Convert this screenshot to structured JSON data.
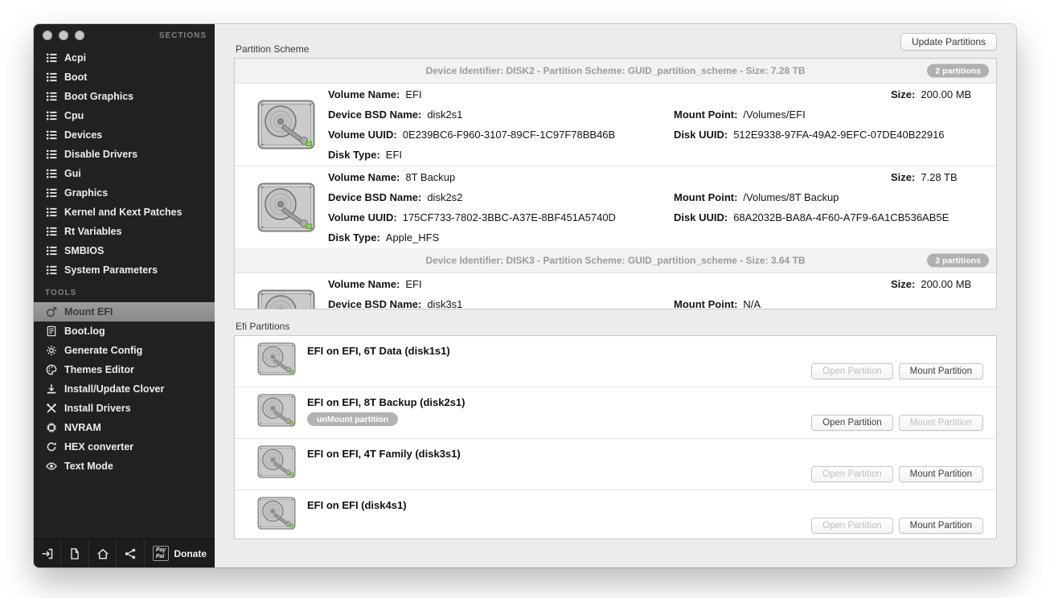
{
  "sidebar": {
    "sections_header": "SECTIONS",
    "tools_header": "TOOLS",
    "sections": [
      {
        "label": "Acpi",
        "icon": "list-icon"
      },
      {
        "label": "Boot",
        "icon": "list-icon"
      },
      {
        "label": "Boot Graphics",
        "icon": "list-icon"
      },
      {
        "label": "Cpu",
        "icon": "list-icon"
      },
      {
        "label": "Devices",
        "icon": "list-icon"
      },
      {
        "label": "Disable Drivers",
        "icon": "list-icon"
      },
      {
        "label": "Gui",
        "icon": "list-icon"
      },
      {
        "label": "Graphics",
        "icon": "list-icon"
      },
      {
        "label": "Kernel and Kext Patches",
        "icon": "list-icon"
      },
      {
        "label": "Rt Variables",
        "icon": "list-icon"
      },
      {
        "label": "SMBIOS",
        "icon": "list-icon"
      },
      {
        "label": "System Parameters",
        "icon": "list-icon"
      }
    ],
    "tools": [
      {
        "label": "Mount EFI",
        "icon": "mount-efi-icon",
        "selected": true
      },
      {
        "label": "Boot.log",
        "icon": "bootlog-icon"
      },
      {
        "label": "Generate Config",
        "icon": "gear-icon"
      },
      {
        "label": "Themes Editor",
        "icon": "themes-icon"
      },
      {
        "label": "Install/Update Clover",
        "icon": "install-clover-icon"
      },
      {
        "label": "Install Drivers",
        "icon": "install-drivers-icon"
      },
      {
        "label": "NVRAM",
        "icon": "nvram-icon"
      },
      {
        "label": "HEX converter",
        "icon": "hex-icon"
      },
      {
        "label": "Text Mode",
        "icon": "eye-icon"
      }
    ],
    "footer": {
      "donate_label": "Donate",
      "paypal_line1": "Pay",
      "paypal_line2": "Pal"
    }
  },
  "main": {
    "partition_scheme": {
      "title": "Partition Scheme",
      "update_button": "Update Partitions",
      "labels": {
        "volume_name": "Volume Name:",
        "size": "Size:",
        "device_bsd_name": "Device BSD Name:",
        "mount_point": "Mount Point:",
        "volume_uuid": "Volume UUID:",
        "disk_uuid": "Disk UUID:",
        "disk_type": "Disk Type:"
      },
      "groups": [
        {
          "header": "Device Identifier: DISK2 - Partition Scheme: GUID_partition_scheme - Size: 7.28 TB",
          "badge": "2 partitions",
          "partitions": [
            {
              "volume_name": "EFI",
              "size": "200.00 MB",
              "device_bsd_name": "disk2s1",
              "mount_point": "/Volumes/EFI",
              "volume_uuid": "0E239BC6-F960-3107-89CF-1C97F78BB46B",
              "disk_uuid": "512E9338-97FA-49A2-9EFC-07DE40B22916",
              "disk_type": "EFI"
            },
            {
              "volume_name": "8T Backup",
              "size": "7.28 TB",
              "device_bsd_name": "disk2s2",
              "mount_point": "/Volumes/8T Backup",
              "volume_uuid": "175CF733-7802-3BBC-A37E-8BF451A5740D",
              "disk_uuid": "68A2032B-BA8A-4F60-A7F9-6A1CB536AB5E",
              "disk_type": "Apple_HFS"
            }
          ]
        },
        {
          "header": "Device Identifier: DISK3 - Partition Scheme: GUID_partition_scheme - Size: 3.64 TB",
          "badge": "2 partitions",
          "partitions": [
            {
              "volume_name": "EFI",
              "size": "200.00 MB",
              "device_bsd_name": "disk3s1",
              "mount_point": "N/A"
            }
          ]
        }
      ]
    },
    "efi_partitions": {
      "title": "Efi Partitions",
      "open_button": "Open Partition",
      "mount_button": "Mount Partition",
      "unmount_button": "unMount partition",
      "rows": [
        {
          "title": "EFI on EFI, 6T Data (disk1s1)",
          "open_enabled": false,
          "mount_enabled": true,
          "show_unmount": false
        },
        {
          "title": "EFI on EFI, 8T Backup (disk2s1)",
          "open_enabled": true,
          "mount_enabled": false,
          "show_unmount": true
        },
        {
          "title": "EFI on EFI, 4T Family (disk3s1)",
          "open_enabled": false,
          "mount_enabled": true,
          "show_unmount": false
        },
        {
          "title": "EFI on EFI (disk4s1)",
          "open_enabled": false,
          "mount_enabled": true,
          "show_unmount": false
        }
      ]
    }
  }
}
